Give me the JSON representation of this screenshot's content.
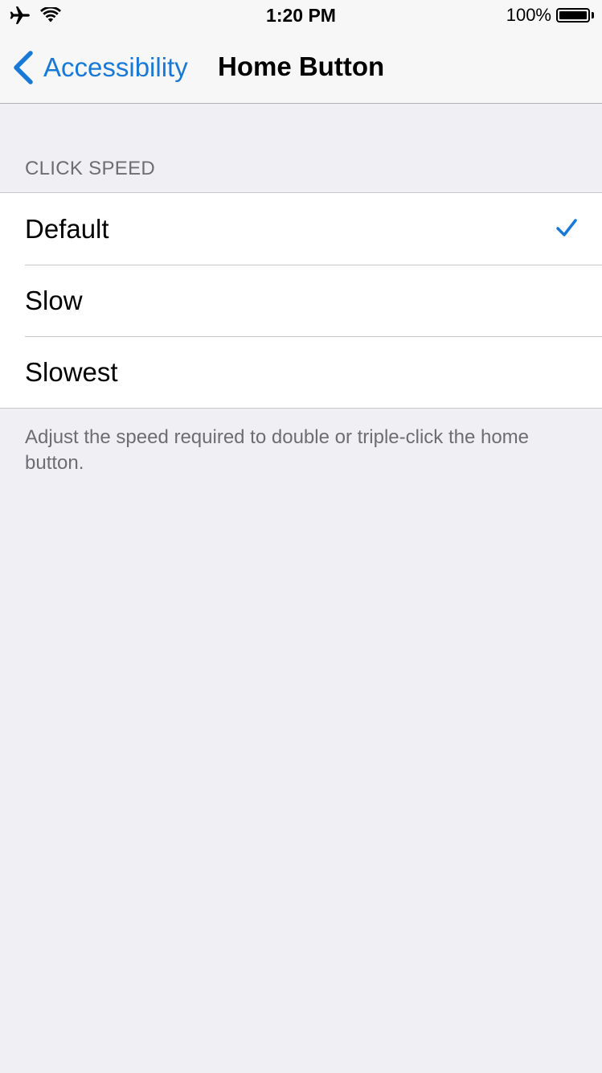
{
  "status_bar": {
    "time": "1:20 PM",
    "battery_percent": "100%",
    "battery_level": 1.0
  },
  "nav": {
    "back_label": "Accessibility",
    "title": "Home Button"
  },
  "section": {
    "header": "CLICK SPEED",
    "items": [
      {
        "label": "Default",
        "selected": true
      },
      {
        "label": "Slow",
        "selected": false
      },
      {
        "label": "Slowest",
        "selected": false
      }
    ],
    "footer": "Adjust the speed required to double or triple-click the home button."
  },
  "colors": {
    "accent": "#1879d6",
    "background": "#efeff4",
    "secondary_text": "#6d6d72"
  },
  "icons": {
    "airplane": "airplane-icon",
    "wifi": "wifi-icon",
    "battery": "battery-icon",
    "back": "chevron-left-icon",
    "check": "checkmark-icon"
  }
}
